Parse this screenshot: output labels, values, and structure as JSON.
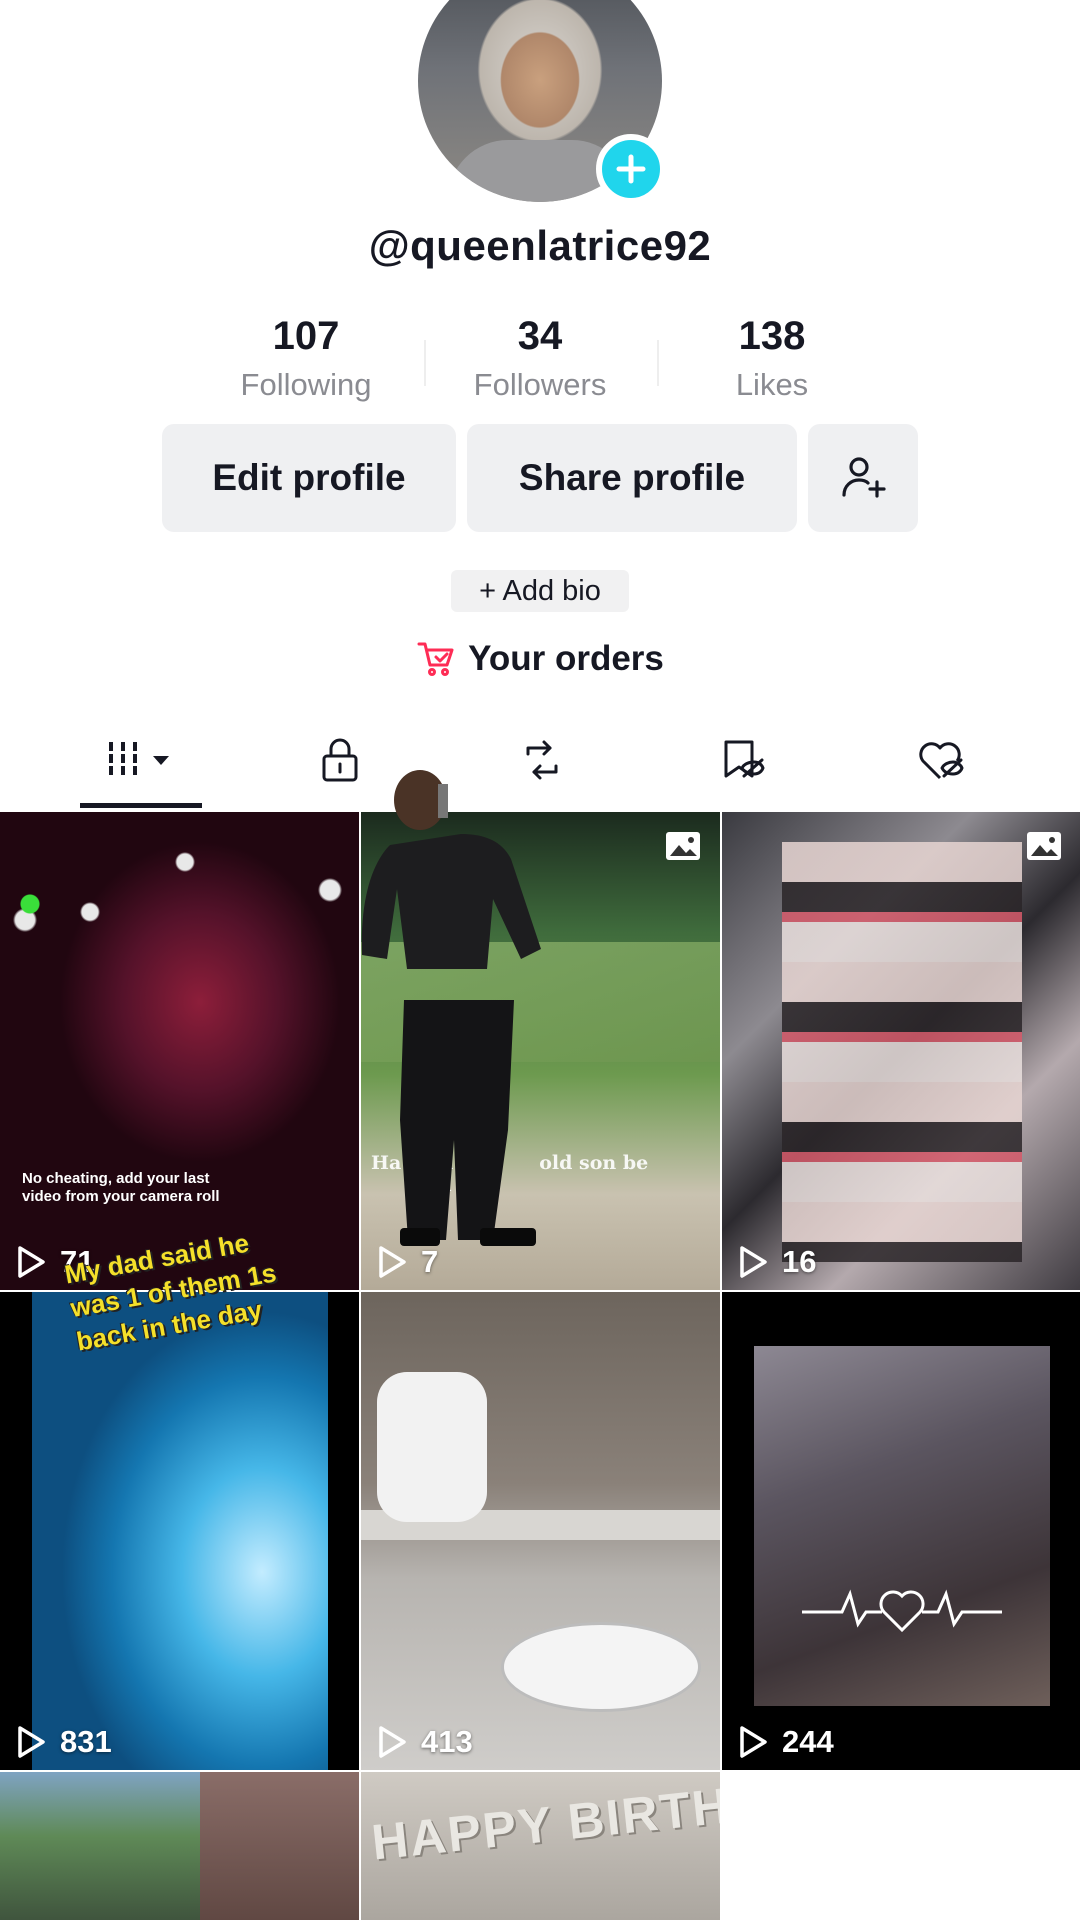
{
  "profile": {
    "username": "@queenlatrice92"
  },
  "stats": [
    {
      "value": "107",
      "label": "Following"
    },
    {
      "value": "34",
      "label": "Followers"
    },
    {
      "value": "138",
      "label": "Likes"
    }
  ],
  "buttons": {
    "edit_profile": "Edit profile",
    "share_profile": "Share profile",
    "add_friend_icon": "add-friend-icon"
  },
  "bio": {
    "add_bio": "+ Add bio"
  },
  "orders": {
    "label": "Your orders",
    "icon": "shopping-cart-icon",
    "icon_color": "#fe2c55"
  },
  "tabs": [
    {
      "name": "videos",
      "icon": "grid-icon",
      "active": true
    },
    {
      "name": "private",
      "icon": "lock-icon",
      "active": false
    },
    {
      "name": "reposts",
      "icon": "repost-icon",
      "active": false
    },
    {
      "name": "favorites",
      "icon": "bookmark-hidden-icon",
      "active": false
    },
    {
      "name": "liked",
      "icon": "heart-hidden-icon",
      "active": false
    }
  ],
  "grid": [
    {
      "views": "71",
      "caption": "No cheating, add your last\nvideo from your camera roll",
      "photo": false
    },
    {
      "views": "7",
      "caption": "Ha      a 12        old son be\n          li",
      "photo": true
    },
    {
      "views": "16",
      "caption": "",
      "photo": true
    },
    {
      "views": "831",
      "caption": "My dad said he was 1 of them 1s back in the day",
      "photo": false
    },
    {
      "views": "413",
      "caption": "",
      "photo": false
    },
    {
      "views": "244",
      "caption": "",
      "photo": false
    },
    {
      "views": "",
      "caption": "",
      "photo": false
    },
    {
      "views": "",
      "caption": "HAPPY BIRTHDAY",
      "photo": false
    }
  ],
  "colors": {
    "accent_cyan": "#20d5ec",
    "accent_red": "#fe2c55",
    "button_bg": "#eff0f2",
    "text_primary": "#161823",
    "text_secondary": "#8a8b91"
  }
}
